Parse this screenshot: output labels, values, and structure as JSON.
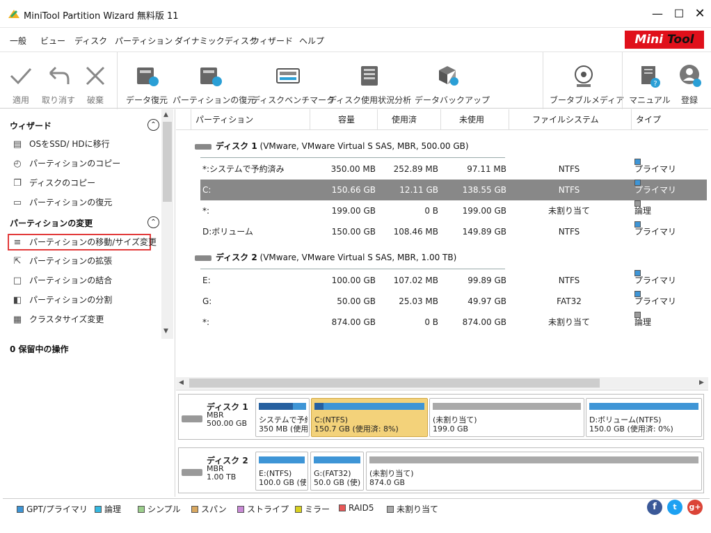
{
  "window": {
    "title": "MiniTool Partition Wizard 無料版 11"
  },
  "menu": [
    "一般",
    "ビュー",
    "ディスク",
    "パーティション",
    "ダイナミックディスク",
    "ウィザード",
    "ヘルプ"
  ],
  "logo": {
    "mini": "Mini",
    "tool": "Tool"
  },
  "toolbar": {
    "apply": "適用",
    "undo": "取り消す",
    "discard": "破棄",
    "data_recovery": "データ復元",
    "partition_recovery": "パーティションの復元",
    "disk_benchmark": "ディスクベンチマーク",
    "space_analyzer": "ディスク使用状況分析",
    "backup": "データバックアップ",
    "bootable_media": "ブータブルメディア",
    "manual": "マニュアル",
    "register": "登録"
  },
  "sidebar": {
    "wizard_title": "ウィザード",
    "wizard_items": [
      "OSをSSD/ HDに移行",
      "パーティションのコピー",
      "ディスクのコピー",
      "パーティションの復元"
    ],
    "change_title": "パーティションの変更",
    "change_items": [
      "パーティションの移動/サイズ変更",
      "パーティションの拡張",
      "パーティションの結合",
      "パーティションの分割",
      "クラスタサイズ変更"
    ],
    "pending": "0 保留中の操作"
  },
  "table": {
    "headers": [
      "パーティション",
      "容量",
      "使用済",
      "未使用",
      "ファイルシステム",
      "タイプ"
    ],
    "disk1_title": "ディスク 1",
    "disk1_info": "(VMware, VMware Virtual S SAS, MBR, 500.00 GB)",
    "disk2_title": "ディスク 2",
    "disk2_info": "(VMware, VMware Virtual S SAS, MBR, 1.00 TB)",
    "disk1_rows": [
      {
        "name": "*:システムで予約済み",
        "capacity": "350.00 MB",
        "used": "252.89 MB",
        "unused": "97.11 MB",
        "fs": "NTFS",
        "type": "プライマリ"
      },
      {
        "name": "C:",
        "capacity": "150.66 GB",
        "used": "12.11 GB",
        "unused": "138.55 GB",
        "fs": "NTFS",
        "type": "プライマリ"
      },
      {
        "name": "*:",
        "capacity": "199.00 GB",
        "used": "0 B",
        "unused": "199.00 GB",
        "fs": "未割り当て",
        "type": "論理"
      },
      {
        "name": "D:ボリューム",
        "capacity": "150.00 GB",
        "used": "108.46 MB",
        "unused": "149.89 GB",
        "fs": "NTFS",
        "type": "プライマリ"
      }
    ],
    "disk2_rows": [
      {
        "name": "E:",
        "capacity": "100.00 GB",
        "used": "107.02 MB",
        "unused": "99.89 GB",
        "fs": "NTFS",
        "type": "プライマリ"
      },
      {
        "name": "G:",
        "capacity": "50.00 GB",
        "used": "25.03 MB",
        "unused": "49.97 GB",
        "fs": "FAT32",
        "type": "プライマリ"
      },
      {
        "name": "*:",
        "capacity": "874.00 GB",
        "used": "0 B",
        "unused": "874.00 GB",
        "fs": "未割り当て",
        "type": "論理"
      }
    ]
  },
  "diskmap": {
    "disk1": {
      "name": "ディスク 1",
      "scheme": "MBR",
      "size": "500.00 GB"
    },
    "disk2": {
      "name": "ディスク 2",
      "scheme": "MBR",
      "size": "1.00 TB"
    },
    "d1p": [
      {
        "l1": "システムで予約",
        "l2": "350 MB (使用"
      },
      {
        "l1": "C:(NTFS)",
        "l2": "150.7 GB (使用済: 8%)"
      },
      {
        "l1": "(未割り当て)",
        "l2": "199.0 GB"
      },
      {
        "l1": "D:ボリューム(NTFS)",
        "l2": "150.0 GB (使用済: 0%)"
      }
    ],
    "d2p": [
      {
        "l1": "E:(NTFS)",
        "l2": "100.0 GB (使"
      },
      {
        "l1": "G:(FAT32)",
        "l2": "50.0 GB (使)"
      },
      {
        "l1": "(未割り当て)",
        "l2": "874.0 GB"
      }
    ]
  },
  "legend": [
    "GPT/プライマリ",
    "論理",
    "シンプル",
    "スパン",
    "ストライプ",
    "ミラー",
    "RAID5",
    "未割り当て"
  ],
  "legend_colors": [
    "#3e95d6",
    "#35b8e0",
    "#9ccf8c",
    "#d9a860",
    "#c98ad6",
    "#d8d020",
    "#e85858",
    "#aaaaaa"
  ],
  "colors": {
    "primary": "#3e95d6",
    "logical": "#9a9a9a",
    "selected_row": "#888888",
    "brand": "#e0101b"
  }
}
